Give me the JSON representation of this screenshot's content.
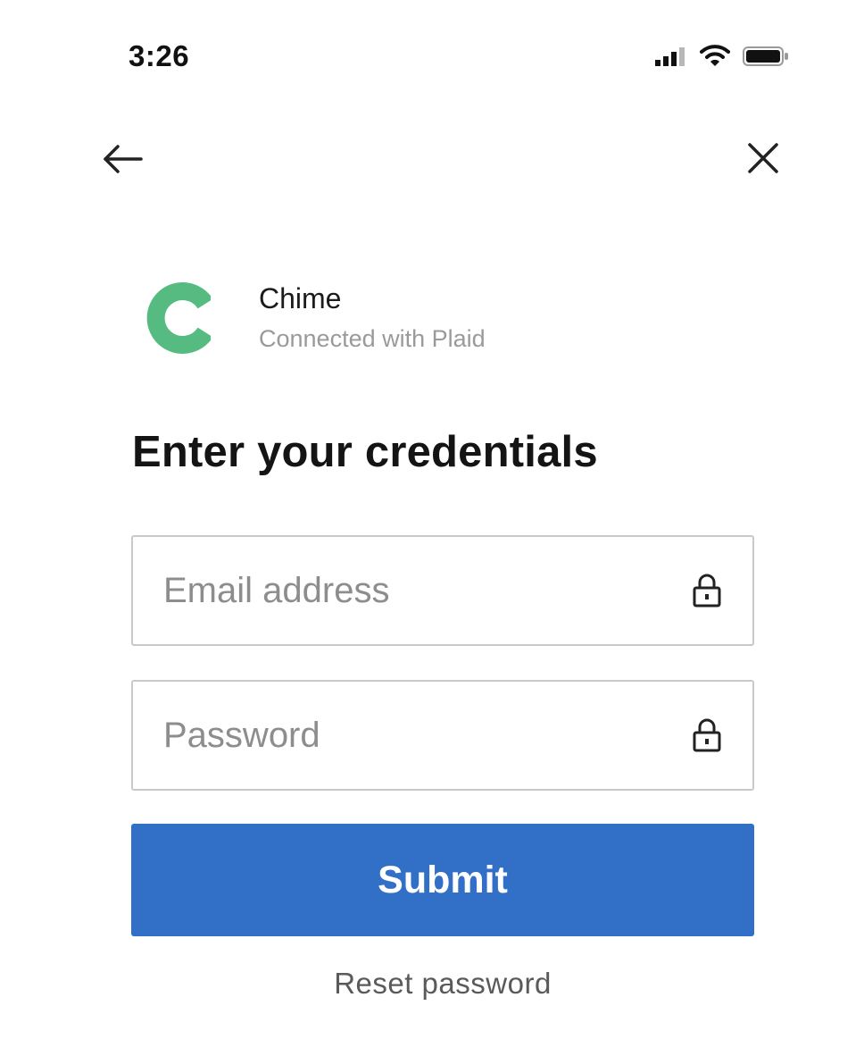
{
  "status_bar": {
    "time": "3:26"
  },
  "icons": {
    "back": "arrow-left-icon",
    "close": "close-icon",
    "lock": "lock-icon",
    "signal": "cellular-signal-icon",
    "wifi": "wifi-icon",
    "battery": "battery-icon"
  },
  "bank": {
    "name": "Chime",
    "subtitle": "Connected with Plaid",
    "logo_letter": "C",
    "logo_color": "#55bb80"
  },
  "form": {
    "heading": "Enter your credentials",
    "email": {
      "placeholder": "Email address",
      "value": ""
    },
    "password": {
      "placeholder": "Password",
      "value": ""
    },
    "submit_label": "Submit",
    "reset_label": "Reset password"
  },
  "colors": {
    "primary": "#3270c8",
    "brand_green": "#55bb80"
  }
}
